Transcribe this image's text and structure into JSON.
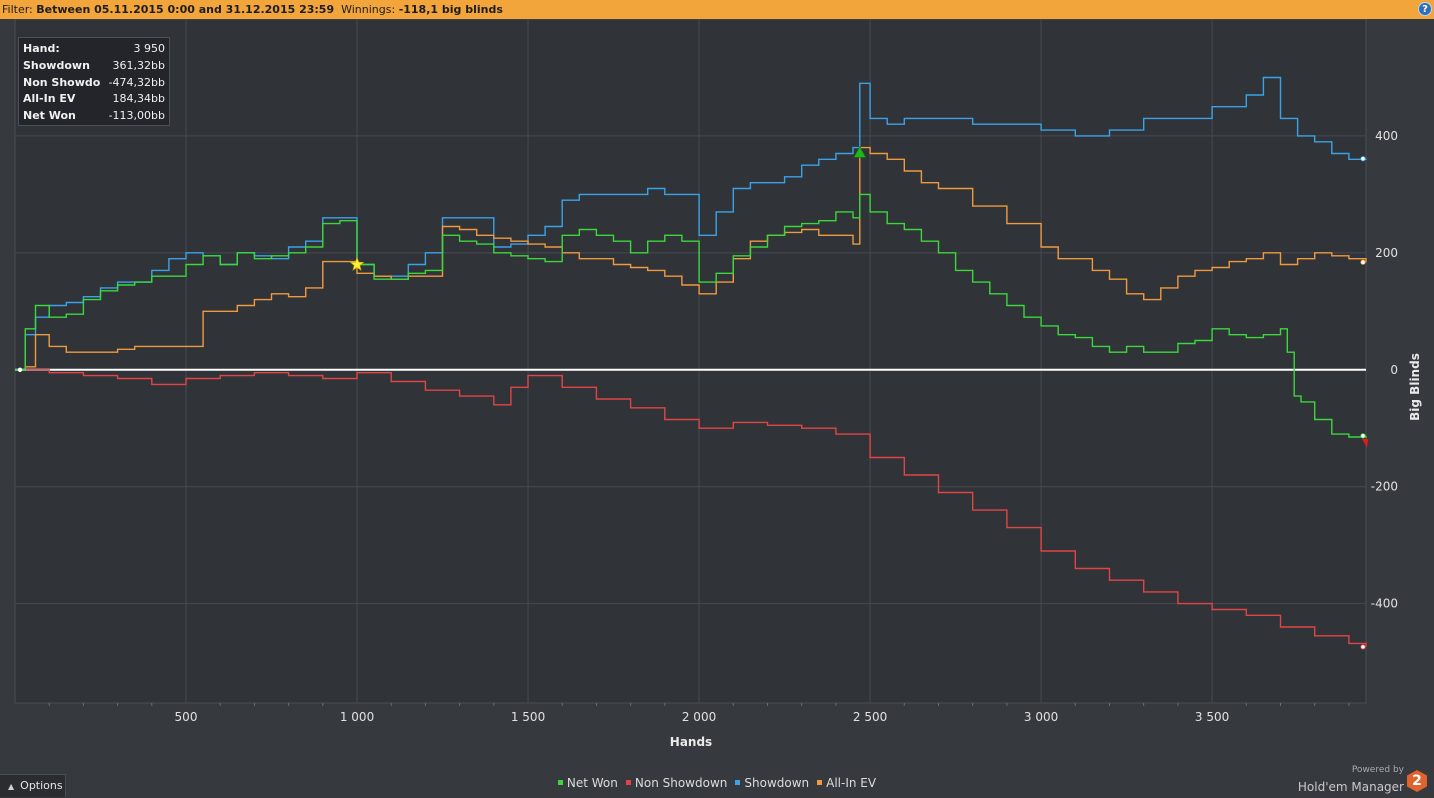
{
  "filter": {
    "prefix": "Filter: ",
    "range": "Between 05.11.2015 0:00 and 31.12.2015 23:59",
    "winnings_label": "Winnings: ",
    "winnings_value": "-118,1 big blinds",
    "help_label": "?"
  },
  "stats": [
    {
      "label": "Hand:",
      "value": "3 950"
    },
    {
      "label": "Showdown",
      "value": "361,32bb"
    },
    {
      "label": "Non Showdown",
      "value": "-474,32bb"
    },
    {
      "label": "All-In EV",
      "value": "184,34bb"
    },
    {
      "label": "Net Won",
      "value": "-113,00bb"
    }
  ],
  "options_label": "Options",
  "brand": {
    "powered_by": "Powered by",
    "name": "Hold'em Manager",
    "logo_text": "2"
  },
  "chart_data": {
    "type": "line",
    "xlabel": "Hands",
    "ylabel": "Big Blinds",
    "xlim": [
      0,
      3950
    ],
    "ylim": [
      -570,
      600
    ],
    "x_ticks": [
      500,
      1000,
      1500,
      2000,
      2500,
      3000,
      3500
    ],
    "x_tick_labels": [
      "500",
      "1 000",
      "1 500",
      "2 000",
      "2 500",
      "3 000",
      "3 500"
    ],
    "y_ticks": [
      -400,
      -200,
      0,
      200,
      400
    ],
    "y_tick_labels": [
      "-400",
      "-200",
      "0",
      "200",
      "400"
    ],
    "grid": true,
    "legend_position": "bottom",
    "zero_line_color": "#ffffff",
    "series": [
      {
        "name": "Net Won",
        "color": "#3bd73b",
        "x": [
          0,
          30,
          60,
          100,
          150,
          200,
          250,
          300,
          350,
          400,
          450,
          500,
          550,
          600,
          650,
          700,
          750,
          800,
          850,
          900,
          950,
          1000,
          1050,
          1100,
          1150,
          1200,
          1250,
          1300,
          1350,
          1400,
          1450,
          1500,
          1550,
          1600,
          1650,
          1700,
          1750,
          1800,
          1850,
          1900,
          1950,
          2000,
          2050,
          2100,
          2150,
          2200,
          2250,
          2300,
          2350,
          2400,
          2450,
          2470,
          2500,
          2550,
          2600,
          2650,
          2700,
          2750,
          2800,
          2850,
          2900,
          2950,
          3000,
          3050,
          3100,
          3150,
          3200,
          3250,
          3300,
          3350,
          3400,
          3450,
          3500,
          3550,
          3600,
          3650,
          3700,
          3720,
          3740,
          3760,
          3800,
          3850,
          3900,
          3950
        ],
        "y": [
          0,
          70,
          110,
          90,
          95,
          120,
          135,
          145,
          150,
          160,
          160,
          180,
          195,
          180,
          200,
          190,
          195,
          200,
          210,
          250,
          255,
          180,
          155,
          155,
          165,
          170,
          230,
          220,
          215,
          200,
          195,
          190,
          185,
          230,
          240,
          230,
          220,
          200,
          220,
          230,
          220,
          150,
          165,
          195,
          210,
          230,
          245,
          250,
          255,
          270,
          260,
          300,
          270,
          250,
          240,
          220,
          200,
          170,
          150,
          130,
          110,
          90,
          75,
          60,
          55,
          40,
          30,
          40,
          30,
          30,
          45,
          50,
          70,
          60,
          55,
          60,
          70,
          30,
          -45,
          -55,
          -85,
          -110,
          -115,
          -113
        ],
        "end_marker": "red"
      },
      {
        "name": "Non Showdown",
        "color": "#e04545",
        "x": [
          0,
          100,
          200,
          300,
          400,
          500,
          600,
          700,
          800,
          900,
          1000,
          1100,
          1200,
          1300,
          1400,
          1450,
          1500,
          1600,
          1700,
          1800,
          1900,
          2000,
          2100,
          2200,
          2300,
          2400,
          2500,
          2600,
          2700,
          2800,
          2900,
          3000,
          3100,
          3200,
          3300,
          3400,
          3500,
          3600,
          3700,
          3800,
          3900,
          3950
        ],
        "y": [
          0,
          -5,
          -10,
          -15,
          -25,
          -15,
          -10,
          -5,
          -10,
          -15,
          -5,
          -20,
          -35,
          -45,
          -60,
          -30,
          -10,
          -30,
          -50,
          -65,
          -85,
          -100,
          -90,
          -95,
          -100,
          -110,
          -150,
          -180,
          -210,
          -240,
          -270,
          -310,
          -340,
          -360,
          -380,
          -400,
          -410,
          -420,
          -440,
          -455,
          -468,
          -474
        ]
      },
      {
        "name": "Showdown",
        "color": "#3aa3e8",
        "x": [
          0,
          30,
          60,
          100,
          150,
          200,
          250,
          300,
          350,
          400,
          450,
          500,
          550,
          600,
          650,
          700,
          750,
          800,
          850,
          900,
          950,
          1000,
          1050,
          1100,
          1150,
          1200,
          1250,
          1300,
          1350,
          1400,
          1450,
          1500,
          1550,
          1600,
          1650,
          1700,
          1750,
          1800,
          1850,
          1900,
          1950,
          2000,
          2050,
          2100,
          2150,
          2200,
          2250,
          2300,
          2350,
          2400,
          2450,
          2470,
          2500,
          2550,
          2600,
          2650,
          2700,
          2800,
          2900,
          3000,
          3100,
          3200,
          3300,
          3400,
          3500,
          3600,
          3650,
          3700,
          3750,
          3800,
          3850,
          3900,
          3950
        ],
        "y": [
          0,
          60,
          90,
          110,
          115,
          125,
          140,
          150,
          150,
          170,
          190,
          200,
          195,
          180,
          200,
          195,
          190,
          210,
          220,
          260,
          260,
          180,
          160,
          160,
          180,
          200,
          260,
          260,
          260,
          210,
          215,
          230,
          245,
          290,
          300,
          300,
          300,
          300,
          310,
          300,
          300,
          230,
          270,
          310,
          320,
          320,
          330,
          350,
          360,
          370,
          380,
          490,
          430,
          420,
          430,
          430,
          430,
          420,
          420,
          410,
          400,
          410,
          430,
          430,
          450,
          470,
          500,
          430,
          400,
          390,
          370,
          360,
          361
        ]
      },
      {
        "name": "All-In EV",
        "color": "#ef9a3f",
        "x": [
          0,
          30,
          60,
          100,
          150,
          200,
          250,
          300,
          350,
          400,
          450,
          500,
          550,
          600,
          650,
          700,
          750,
          800,
          850,
          900,
          950,
          1000,
          1050,
          1100,
          1150,
          1200,
          1250,
          1300,
          1350,
          1400,
          1450,
          1500,
          1550,
          1600,
          1650,
          1700,
          1750,
          1800,
          1850,
          1900,
          1950,
          2000,
          2050,
          2100,
          2150,
          2200,
          2250,
          2300,
          2350,
          2400,
          2450,
          2470,
          2500,
          2550,
          2600,
          2650,
          2700,
          2800,
          2900,
          3000,
          3050,
          3100,
          3150,
          3200,
          3250,
          3300,
          3350,
          3400,
          3450,
          3500,
          3550,
          3600,
          3650,
          3700,
          3750,
          3800,
          3850,
          3900,
          3950
        ],
        "y": [
          0,
          5,
          60,
          40,
          30,
          30,
          30,
          35,
          40,
          40,
          40,
          40,
          100,
          100,
          110,
          120,
          130,
          125,
          140,
          185,
          185,
          165,
          160,
          155,
          160,
          160,
          245,
          240,
          230,
          225,
          220,
          215,
          210,
          200,
          190,
          190,
          180,
          175,
          170,
          160,
          145,
          130,
          150,
          190,
          220,
          230,
          235,
          240,
          230,
          230,
          215,
          380,
          370,
          360,
          340,
          320,
          310,
          280,
          250,
          210,
          190,
          190,
          170,
          155,
          130,
          120,
          140,
          160,
          170,
          175,
          185,
          190,
          200,
          180,
          190,
          200,
          195,
          190,
          184
        ]
      }
    ],
    "markers": [
      {
        "type": "star",
        "x": 1000,
        "y": 180,
        "color": "#ffee33"
      },
      {
        "type": "triangle",
        "x": 2470,
        "y": 370,
        "color": "#1fb51f"
      }
    ]
  }
}
